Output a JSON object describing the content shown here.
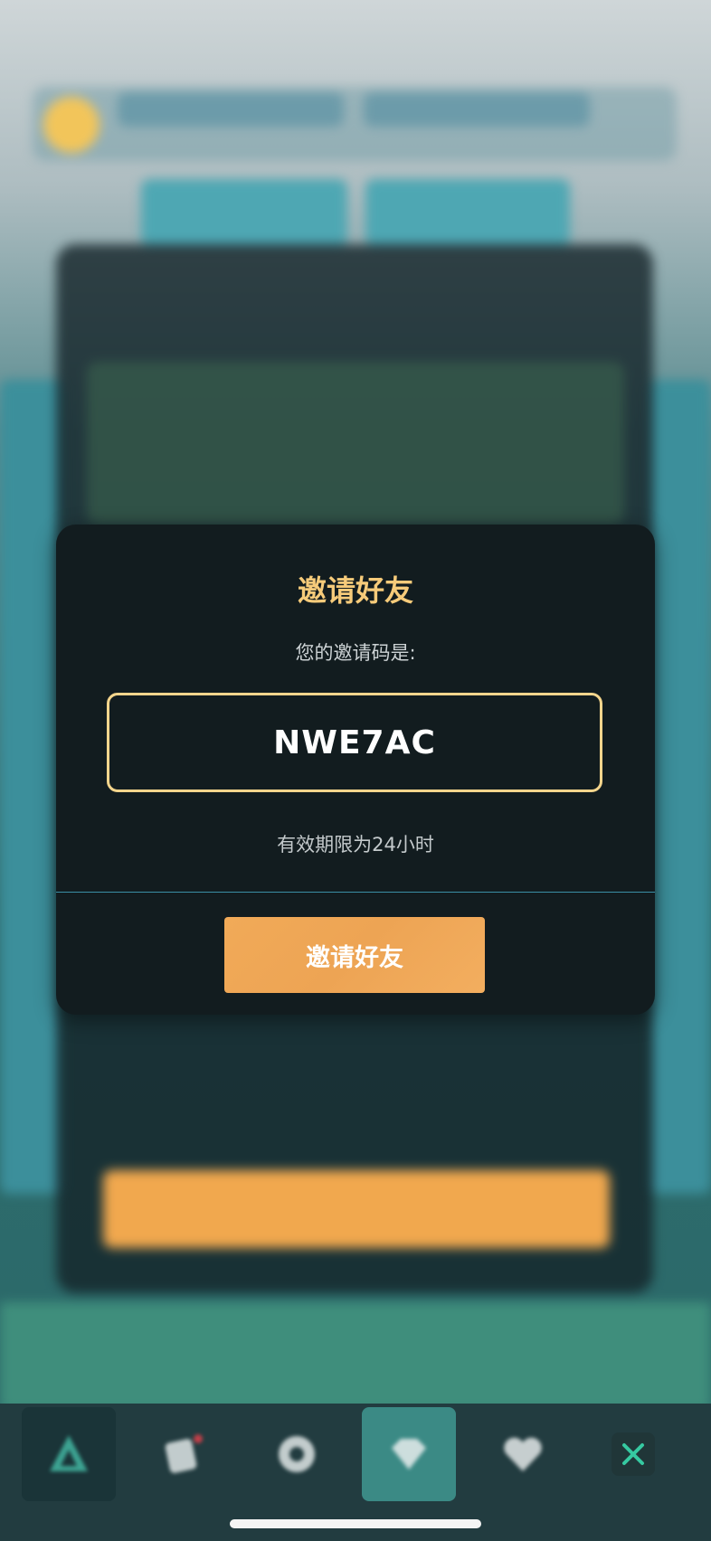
{
  "modal": {
    "title": "邀请好友",
    "code_prompt": "您的邀请码是:",
    "invite_code": "NWE7AC",
    "validity_note": "有效期限为24小时",
    "invite_button_label": "邀请好友"
  },
  "bottom_nav": {
    "items": [
      {
        "icon": "tree-icon"
      },
      {
        "icon": "cards-icon"
      },
      {
        "icon": "gear-icon"
      },
      {
        "icon": "diamond-icon"
      },
      {
        "icon": "heart-icon"
      }
    ],
    "close_icon": "close-icon"
  },
  "colors": {
    "modal_bg": "#121c1f",
    "title": "#f6cb7a",
    "code_border": "#f4d58c",
    "button": "#f1aa58",
    "close_icon": "#36c9a1"
  }
}
